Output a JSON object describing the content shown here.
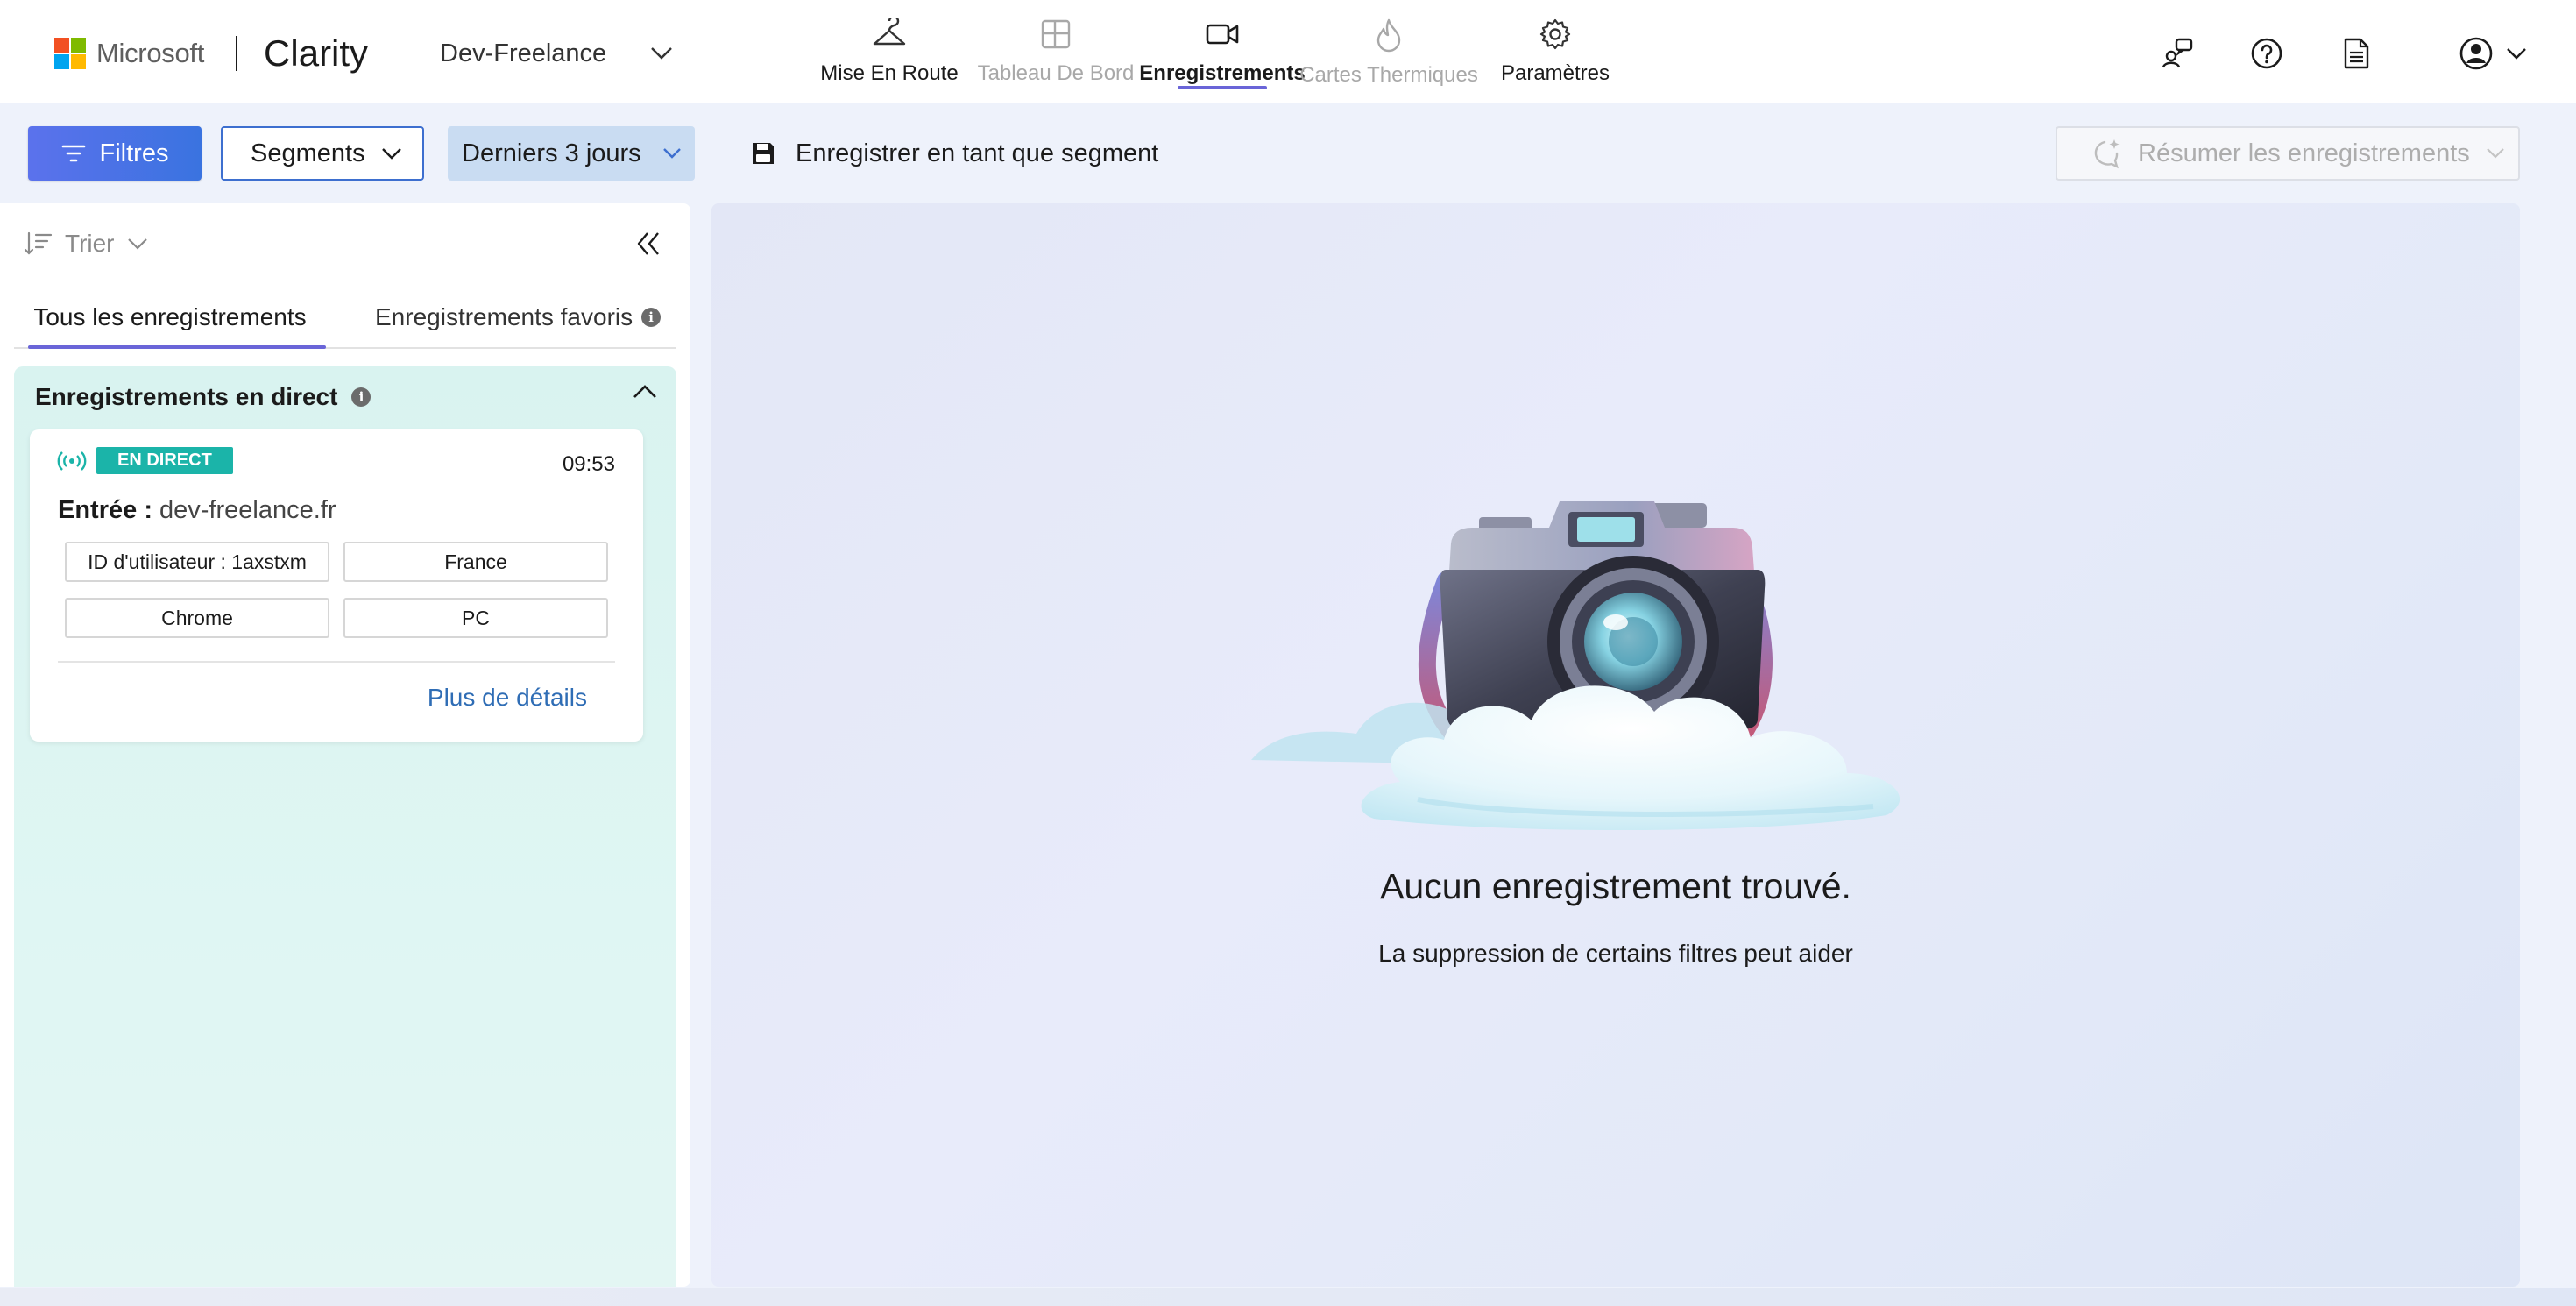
{
  "brand": {
    "company": "Microsoft",
    "product": "Clarity",
    "logo_colors": [
      "#f25022",
      "#7fba00",
      "#00a4ef",
      "#ffb900"
    ]
  },
  "project": {
    "name": "Dev-Freelance"
  },
  "nav": {
    "items": [
      {
        "label": "Mise En Route",
        "icon": "hanger-icon",
        "state": "normal"
      },
      {
        "label": "Tableau De Bord",
        "icon": "dashboard-icon",
        "state": "disabled"
      },
      {
        "label": "Enregistrements",
        "icon": "video-camera-icon",
        "state": "active"
      },
      {
        "label": "Cartes Thermiques",
        "icon": "flame-icon",
        "state": "disabled"
      },
      {
        "label": "Paramètres",
        "icon": "gear-icon",
        "state": "normal"
      }
    ]
  },
  "header_icons": [
    "share-users-icon",
    "help-icon",
    "document-icon",
    "account-icon",
    "chevron-down-icon"
  ],
  "toolbar": {
    "filters_label": "Filtres",
    "segments_label": "Segments",
    "date_range_label": "Derniers 3 jours",
    "save_segment_label": "Enregistrer en tant que segment",
    "summarize_label": "Résumer les enregistrements"
  },
  "sidebar": {
    "sort_label": "Trier",
    "tabs": [
      {
        "label": "Tous les enregistrements",
        "active": true
      },
      {
        "label": "Enregistrements favoris",
        "active": false
      }
    ],
    "live_section": {
      "title": "Enregistrements en direct",
      "card": {
        "badge": "EN DIRECT",
        "time": "09:53",
        "entry_label": "Entrée :",
        "entry_url": "dev-freelance.fr",
        "chips": [
          "ID d'utilisateur : 1axstxm",
          "France",
          "Chrome",
          "PC"
        ],
        "more_link": "Plus de détails"
      }
    }
  },
  "main": {
    "empty_title": "Aucun enregistrement trouvé.",
    "empty_subtitle": "La suppression de certains filtres peut aider"
  },
  "colors": {
    "accent": "#6a65d8",
    "primary_button": "#3a73e0",
    "live_badge": "#1bb4a9",
    "link": "#2f6db5"
  }
}
